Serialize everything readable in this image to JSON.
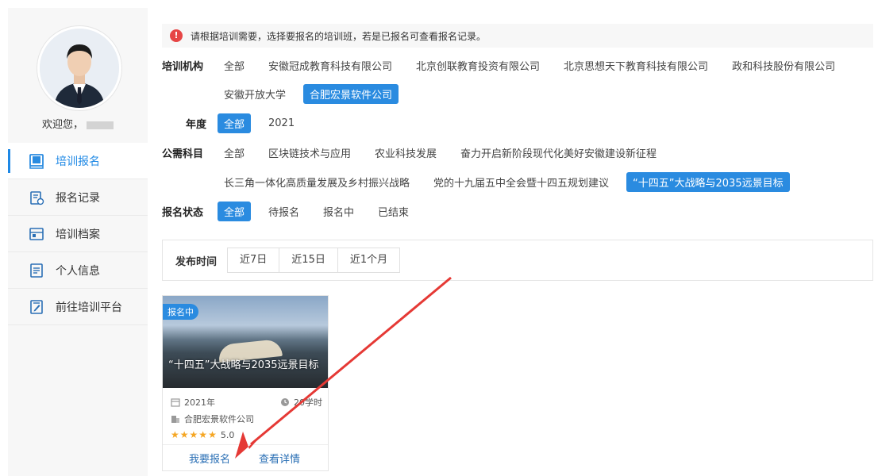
{
  "sidebar": {
    "welcome": "欢迎您，",
    "menu": [
      {
        "label": "培训报名",
        "icon": "book-icon",
        "active": true
      },
      {
        "label": "报名记录",
        "icon": "record-icon",
        "active": false
      },
      {
        "label": "培训档案",
        "icon": "archive-icon",
        "active": false
      },
      {
        "label": "个人信息",
        "icon": "document-icon",
        "active": false
      },
      {
        "label": "前往培训平台",
        "icon": "edit-icon",
        "active": false
      }
    ]
  },
  "notice": {
    "icon": "warning-icon",
    "text": "请根据培训需要，选择要报名的培训班，若是已报名可查看报名记录。"
  },
  "filters": {
    "org": {
      "label": "培训机构",
      "options": [
        "全部",
        "安徽冠成教育科技有限公司",
        "北京创联教育投资有限公司",
        "北京思想天下教育科技有限公司",
        "政和科技股份有限公司",
        "安徽开放大学",
        "合肥宏景软件公司"
      ],
      "selected": "合肥宏景软件公司"
    },
    "year": {
      "label": "年度",
      "options": [
        "全部",
        "2021"
      ],
      "selected": "全部"
    },
    "subject": {
      "label": "公需科目",
      "options": [
        "全部",
        "区块链技术与应用",
        "农业科技发展",
        "奋力开启新阶段现代化美好安徽建设新征程",
        "长三角一体化高质量发展及乡村振兴战略",
        "党的十九届五中全会暨十四五规划建议",
        "“十四五”大战略与2035远景目标"
      ],
      "selected": "“十四五”大战略与2035远景目标"
    },
    "status": {
      "label": "报名状态",
      "options": [
        "全部",
        "待报名",
        "报名中",
        "已结束"
      ],
      "selected": "全部"
    }
  },
  "time_filter": {
    "label": "发布时间",
    "options": [
      "近7日",
      "近15日",
      "近1个月"
    ]
  },
  "course_card": {
    "badge": "报名中",
    "title": "“十四五”大战略与2035远景目标",
    "year": "2021年",
    "hours": "20学时",
    "org": "合肥宏景软件公司",
    "rating": "5.0",
    "stars": 5,
    "enroll_label": "我要报名",
    "detail_label": "查看详情"
  },
  "colors": {
    "accent": "#2a8be0",
    "annotation_arrow": "#e53935",
    "warning": "#e64545"
  }
}
